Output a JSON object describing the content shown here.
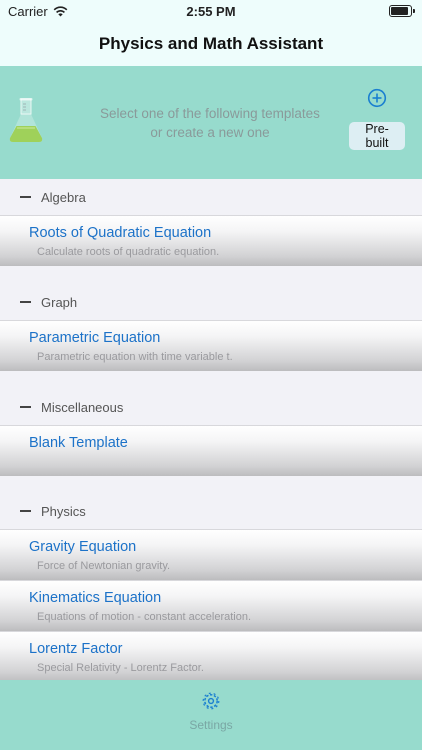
{
  "status_bar": {
    "carrier": "Carrier",
    "time": "2:55 PM"
  },
  "nav": {
    "title": "Physics and Math Assistant"
  },
  "header": {
    "line1": "Select one of the following templates",
    "line2": "or create a new one",
    "prebuilt_label": "Pre-built"
  },
  "sections": [
    {
      "title": "Algebra",
      "items": [
        {
          "title": "Roots of Quadratic Equation",
          "subtitle": "Calculate roots of quadratic equation."
        }
      ]
    },
    {
      "title": "Graph",
      "items": [
        {
          "title": "Parametric Equation",
          "subtitle": "Parametric equation with time variable t."
        }
      ]
    },
    {
      "title": "Miscellaneous",
      "items": [
        {
          "title": "Blank Template",
          "subtitle": ""
        }
      ]
    },
    {
      "title": "Physics",
      "items": [
        {
          "title": "Gravity Equation",
          "subtitle": "Force of Newtonian gravity."
        },
        {
          "title": "Kinematics Equation",
          "subtitle": "Equations of motion - constant acceleration."
        },
        {
          "title": "Lorentz Factor",
          "subtitle": "Special Relativity - Lorentz Factor."
        }
      ]
    }
  ],
  "tab_bar": {
    "settings_label": "Settings"
  },
  "colors": {
    "accent": "#97dbcd",
    "link": "#1c72c8",
    "icon": "#1a7fd0"
  },
  "icons": {
    "flask": "flask-icon",
    "plus": "plus-circle-icon",
    "settings": "gear-icon",
    "wifi": "wifi-icon",
    "battery": "battery-icon"
  }
}
